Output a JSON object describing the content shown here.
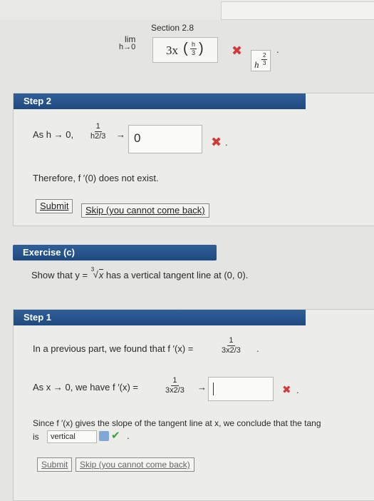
{
  "top": {
    "section_label": "Section 2.8",
    "lim_label": "lim",
    "lim_sub": "h→0",
    "expr_3x": "3x",
    "expr_frac_num": "h",
    "expr_frac_den": "3",
    "answer_h": "h",
    "answer_exp_num": "2",
    "answer_exp_den": "3",
    "wrong_mark": "✖",
    "dot": "."
  },
  "step2": {
    "title": "Step 2",
    "as_h": "As h → 0,",
    "frac_num": "1",
    "frac_den": "h2/3",
    "arrow": "→",
    "answer": "0",
    "wrong_mark": "✖",
    "dot": ".",
    "therefore": "Therefore, f ′(0) does not exist.",
    "submit_label": "Submit",
    "skip_label": "Skip (you cannot come back)"
  },
  "exercise": {
    "title": "Exercise (c)",
    "prompt_prefix": "Show that y = ",
    "root_index": "3",
    "root_radicand": "x",
    "prompt_suffix": " has a vertical tangent line at (0, 0)."
  },
  "step1": {
    "title": "Step 1",
    "line1": "In a previous part, we found that f ′(x) = ",
    "frac1_num": "1",
    "frac1_den": "3x2/3",
    "line1_end": ".",
    "line2": "As x → 0, we have f ′(x) = ",
    "frac2_num": "1",
    "frac2_den": "3x2/3",
    "arrow": "→",
    "answer": "",
    "wrong_mark": "✖",
    "dot": ".",
    "since_line": "Since f ′(x) gives the slope of the tangent line at x, we conclude that the tang",
    "is_label": "is",
    "select_value": "vertical",
    "check_mark": "✔",
    "submit_label": "Submit",
    "skip_label": "Skip (you cannot come back)"
  },
  "colors": {
    "accent": "#1f4a80",
    "error": "#d23a3a",
    "success": "#3aa03a"
  }
}
